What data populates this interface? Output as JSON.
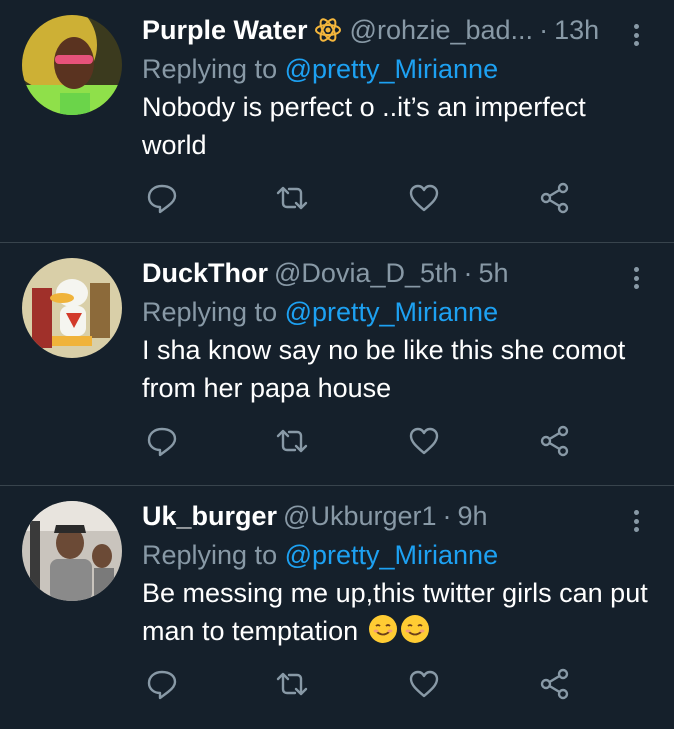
{
  "tweets": [
    {
      "name": "Purple Water",
      "handle": "@rohzie_bad...",
      "separator": "·",
      "time": "13h",
      "replying_prefix": "Replying to ",
      "replying_to": "@pretty_Mirianne",
      "text": "Nobody is perfect o ..it’s an imperfect world",
      "has_badge": true,
      "avatar_bg": "#e8c53a"
    },
    {
      "name": "DuckThor",
      "handle": "@Dovia_D_5th",
      "separator": "·",
      "time": "5h",
      "replying_prefix": "Replying to ",
      "replying_to": "@pretty_Mirianne",
      "text": "I sha know say no be like this she comot from her papa house",
      "has_badge": false,
      "avatar_bg": "#d9cfa8"
    },
    {
      "name": "Uk_burger",
      "handle": "@Ukburger1",
      "separator": "·",
      "time": "9h",
      "replying_prefix": "Replying to ",
      "replying_to": "@pretty_Mirianne",
      "text": "Be messing me up,this twitter girls can put man to temptation ",
      "has_badge": false,
      "avatar_bg": "#c9c4bd"
    }
  ],
  "icons": {
    "reply": "reply-icon",
    "retweet": "retweet-icon",
    "like": "heart-icon",
    "share": "share-icon",
    "more": "more-vertical-icon",
    "badge": "atom-icon",
    "emoji": "smiling-face-icon"
  },
  "colors": {
    "background": "#15202b",
    "secondary_text": "#8899a6",
    "mention": "#1da1f2",
    "divider": "#38444d",
    "badge": "#f4b63c"
  }
}
